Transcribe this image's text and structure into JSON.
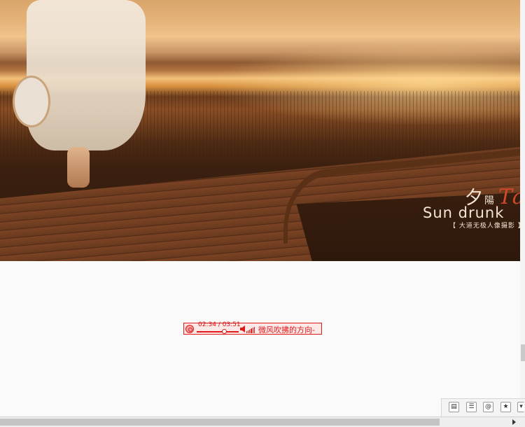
{
  "banner": {
    "brand_cn_main": "夕",
    "brand_cn_small": "陽",
    "brand_cn_red": "Ta",
    "brand_en": "Sun drunk",
    "brand_sub": "【 大道无极人像摄影 】"
  },
  "player": {
    "time": "02:34 / 03:51",
    "progress": 0.66,
    "song_title": "微风吹拂的方向-"
  },
  "toolbar": {
    "icons": [
      "page-icon",
      "abc-icon",
      "at-icon",
      "star-icon"
    ]
  },
  "colors": {
    "player_accent": "#e01919",
    "page_background": "#fafafa"
  }
}
